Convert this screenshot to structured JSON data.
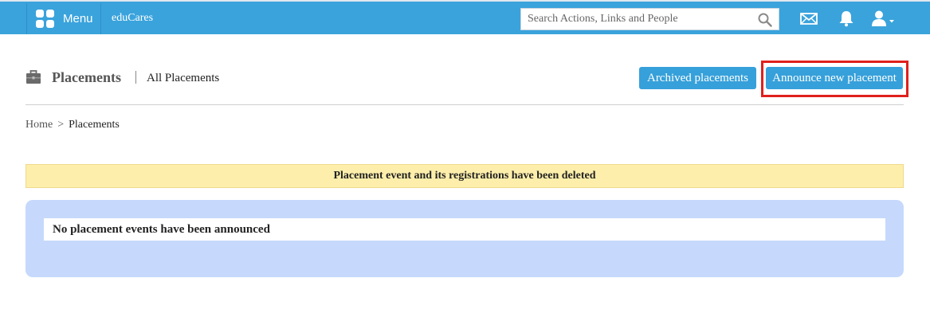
{
  "topbar": {
    "menu_label": "Menu",
    "brand": "eduCares",
    "search_placeholder": "Search Actions, Links and People",
    "icons": [
      "grid-icon",
      "search-icon",
      "mail-icon",
      "bell-icon",
      "user-icon"
    ],
    "color": "#3aa3dc"
  },
  "header": {
    "title": "Placements",
    "subtitle": "All Placements",
    "icon": "briefcase-icon",
    "buttons": {
      "archived": "Archived placements",
      "announce": "Announce new placement"
    },
    "button_color": "#36a0da",
    "highlight_color": "#e0201c"
  },
  "breadcrumb": {
    "home": "Home",
    "separator": ">",
    "current": "Placements"
  },
  "alert": {
    "message": "Placement event and its registrations have been deleted",
    "color": "#fdefab"
  },
  "panel": {
    "message": "No placement events have been announced",
    "color": "#c6d9fc"
  }
}
